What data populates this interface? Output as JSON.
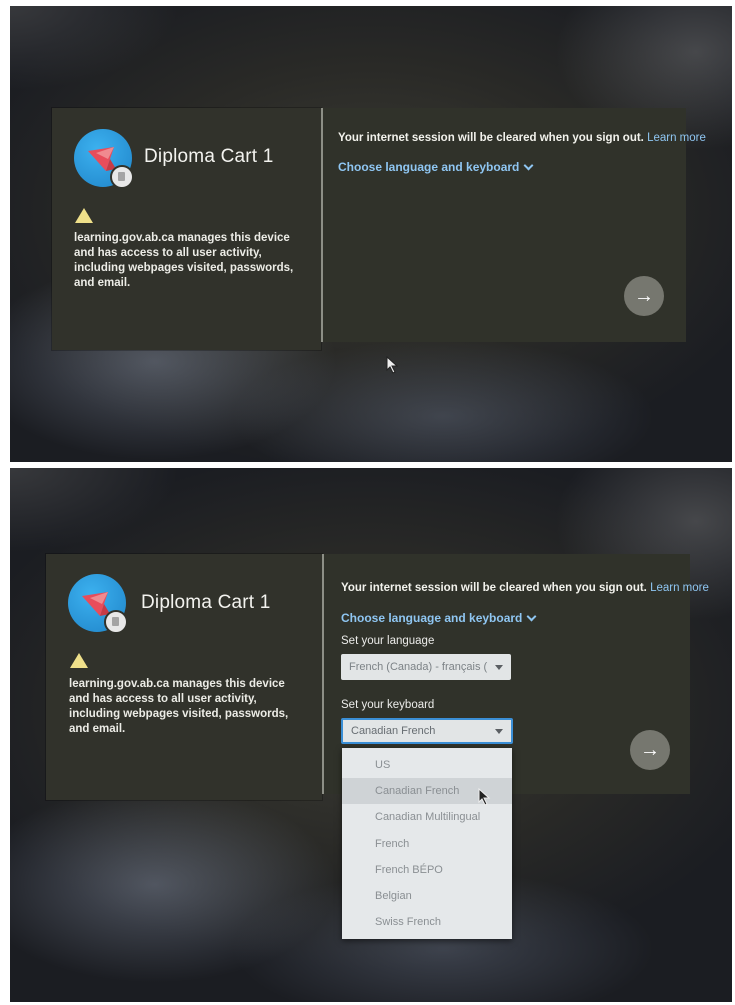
{
  "screen_before": {
    "device_name": "Diploma Cart 1",
    "management_notice": "learning.gov.ab.ca manages this device and has access to all user activity, including webpages visited, passwords, and email.",
    "session_notice": "Your internet session will be cleared when you sign out.",
    "learn_more": "Learn more",
    "language_toggle": "Choose language and keyboard",
    "next_icon": "arrow-right-icon"
  },
  "screen_after": {
    "device_name": "Diploma Cart 1",
    "management_notice": "learning.gov.ab.ca manages this device and has access to all user activity, including webpages visited, passwords, and email.",
    "session_notice": "Your internet session will be cleared when you sign out.",
    "learn_more": "Learn more",
    "language_toggle": "Choose language and keyboard",
    "language_label": "Set your language",
    "language_value": "French (Canada) - français (",
    "keyboard_label": "Set your keyboard",
    "keyboard_value": "Canadian French",
    "keyboard_options": [
      "US",
      "Canadian French",
      "Canadian Multilingual",
      "French",
      "French BÉPO",
      "Belgian",
      "Swiss French"
    ],
    "hovered_option": "Canadian French",
    "next_icon": "arrow-right-icon"
  },
  "colors": {
    "panel": "#31322b",
    "link": "#8fc6f2",
    "warning": "#efe08a",
    "avatar": "#2a98dc"
  }
}
